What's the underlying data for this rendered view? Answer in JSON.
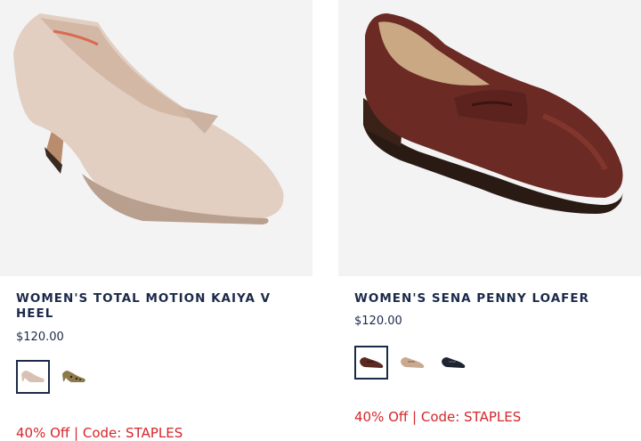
{
  "products": [
    {
      "title": "WOMEN'S TOTAL MOTION KAIYA V HEEL",
      "price": "$120.00",
      "promo": "40% Off | Code: STAPLES",
      "swatches": [
        {
          "color": "#d8c1b3",
          "selected": true,
          "icon": "nude-heel-swatch-icon"
        },
        {
          "color": "#8d7a4a",
          "selected": false,
          "icon": "leopard-heel-swatch-icon"
        }
      ]
    },
    {
      "title": "WOMEN'S SENA PENNY LOAFER",
      "price": "$120.00",
      "promo": "40% Off | Code: STAPLES",
      "swatches": [
        {
          "color": "#5a2a22",
          "selected": true,
          "icon": "burgundy-loafer-swatch-icon"
        },
        {
          "color": "#c9a98f",
          "selected": false,
          "icon": "tan-loafer-swatch-icon"
        },
        {
          "color": "#1e2430",
          "selected": false,
          "icon": "black-loafer-swatch-icon"
        }
      ]
    }
  ],
  "colors": {
    "title": "#1b2a4a",
    "promo": "#d6262b",
    "image_bg": "#f3f3f3"
  }
}
